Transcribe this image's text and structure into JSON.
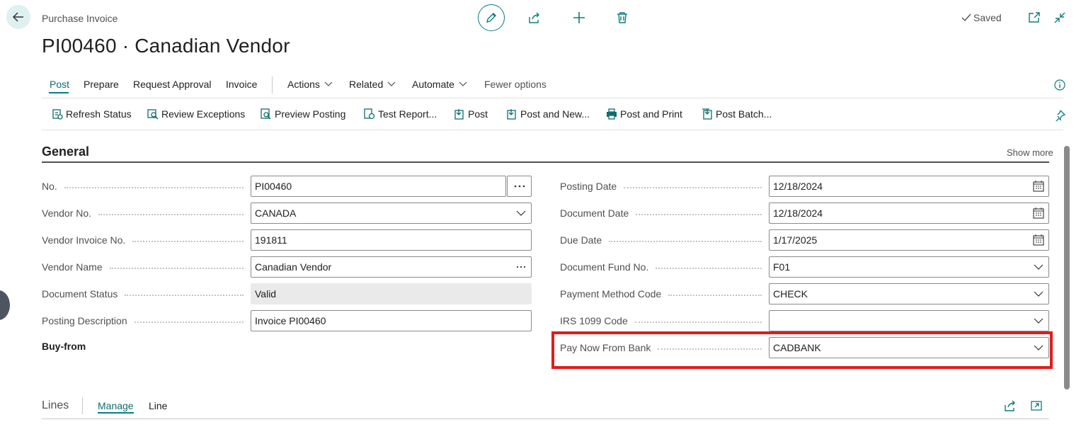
{
  "header": {
    "page_kind": "Purchase Invoice",
    "title": "PI00460 · Canadian Vendor",
    "saved_label": "Saved"
  },
  "action_tabs": {
    "post": "Post",
    "prepare": "Prepare",
    "request_approval": "Request Approval",
    "invoice": "Invoice",
    "actions": "Actions",
    "related": "Related",
    "automate": "Automate",
    "fewer_options": "Fewer options"
  },
  "actions": {
    "refresh_status": "Refresh Status",
    "review_exceptions": "Review Exceptions",
    "preview_posting": "Preview Posting",
    "test_report": "Test Report...",
    "post": "Post",
    "post_and_new": "Post and New...",
    "post_and_print": "Post and Print",
    "post_batch": "Post Batch..."
  },
  "general": {
    "title": "General",
    "show_more": "Show more",
    "buy_from": "Buy-from",
    "left": {
      "no": {
        "label": "No.",
        "value": "PI00460"
      },
      "vendor_no": {
        "label": "Vendor No.",
        "value": "CANADA"
      },
      "vendor_invoice_no": {
        "label": "Vendor Invoice No.",
        "value": "191811"
      },
      "vendor_name": {
        "label": "Vendor Name",
        "value": "Canadian Vendor"
      },
      "document_status": {
        "label": "Document Status",
        "value": "Valid"
      },
      "posting_description": {
        "label": "Posting Description",
        "value": "Invoice PI00460"
      }
    },
    "right": {
      "posting_date": {
        "label": "Posting Date",
        "value": "12/18/2024"
      },
      "document_date": {
        "label": "Document Date",
        "value": "12/18/2024"
      },
      "due_date": {
        "label": "Due Date",
        "value": "1/17/2025"
      },
      "document_fund_no": {
        "label": "Document Fund No.",
        "value": "F01"
      },
      "payment_method_code": {
        "label": "Payment Method Code",
        "value": "CHECK"
      },
      "irs_1099_code": {
        "label": "IRS 1099 Code",
        "value": ""
      },
      "pay_now_from_bank": {
        "label": "Pay Now From Bank",
        "value": "CADBANK"
      }
    }
  },
  "lines": {
    "title": "Lines",
    "tab_manage": "Manage",
    "tab_line": "Line"
  },
  "colors": {
    "accent": "#0e7b7b",
    "highlight": "#e21b1b"
  }
}
